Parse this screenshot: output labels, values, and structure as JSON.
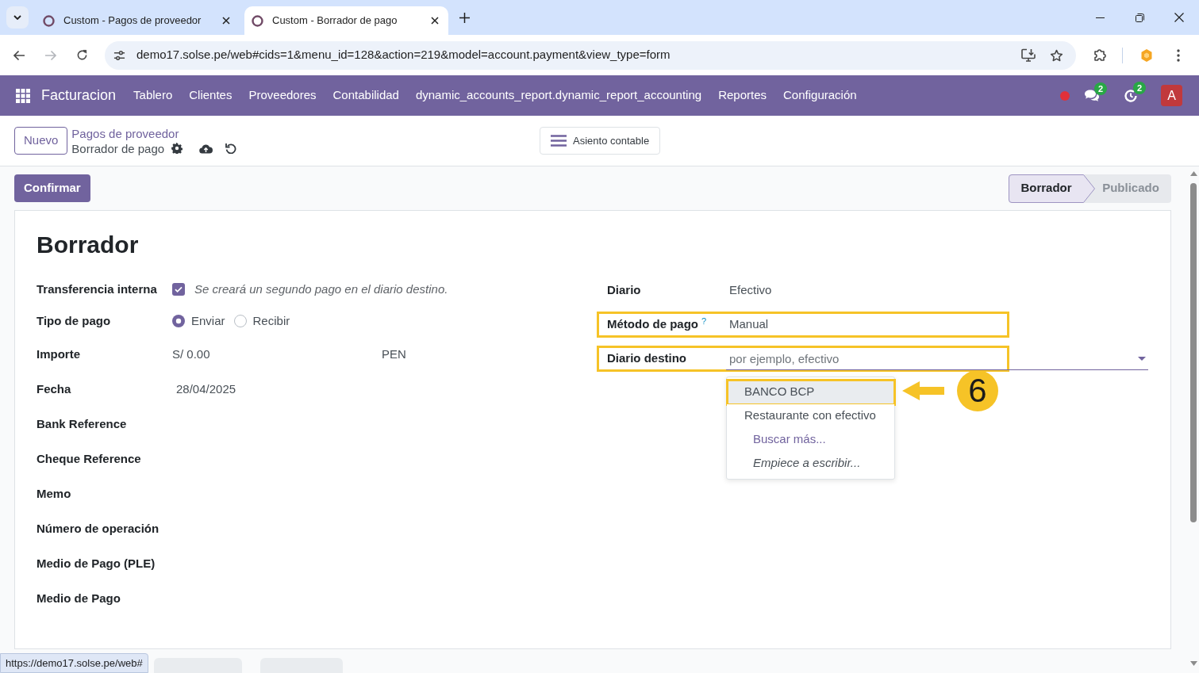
{
  "browser": {
    "tabs": [
      {
        "title": "Custom - Pagos de proveedor",
        "selected": false
      },
      {
        "title": "Custom - Borrador de pago",
        "selected": true
      }
    ],
    "url": "demo17.solse.pe/web#cids=1&menu_id=128&action=219&model=account.payment&view_type=form",
    "forward_disabled": true
  },
  "navbar": {
    "app_name": "Facturacion",
    "menu": [
      "Tablero",
      "Clientes",
      "Proveedores",
      "Contabilidad",
      "dynamic_accounts_report.dynamic_report_accounting",
      "Reportes",
      "Configuración"
    ],
    "messages_count": "2",
    "activities_count": "2",
    "avatar_letter": "A"
  },
  "control_panel": {
    "new_button": "Nuevo",
    "breadcrumb": "Pagos de proveedor",
    "record_name": "Borrador de pago",
    "action_button": "Asiento contable"
  },
  "status_row": {
    "buttons": [
      "Confirmar"
    ],
    "stages": [
      {
        "label": "Borrador",
        "selected": true
      },
      {
        "label": "Publicado",
        "selected": false
      }
    ]
  },
  "form": {
    "title": "Borrador",
    "left_fields": [
      {
        "kind": "checkbox",
        "label": "Transferencia interna",
        "checked": true,
        "note": "Se creará un segundo pago en el diario destino."
      },
      {
        "kind": "radio",
        "label": "Tipo de pago",
        "options": [
          {
            "label": "Enviar",
            "selected": true
          },
          {
            "label": "Recibir",
            "selected": false
          }
        ]
      },
      {
        "kind": "amount",
        "label": "Importe",
        "value": "S/ 0.00",
        "currency": "PEN"
      },
      {
        "kind": "text",
        "label": "Fecha",
        "value": "28/04/2025"
      },
      {
        "kind": "empty",
        "label": "Bank Reference"
      },
      {
        "kind": "empty",
        "label": "Cheque Reference"
      },
      {
        "kind": "empty",
        "label": "Memo"
      },
      {
        "kind": "empty",
        "label": "Número de operación"
      },
      {
        "kind": "empty",
        "label": "Medio de Pago (PLE)"
      },
      {
        "kind": "empty",
        "label": "Medio de Pago"
      }
    ],
    "right_fields": [
      {
        "kind": "text",
        "label": "Diario",
        "value": "Efectivo",
        "highlighted": false
      },
      {
        "kind": "text",
        "label": "Método de pago",
        "help": "?",
        "value": "Manual",
        "highlighted": true
      },
      {
        "kind": "select",
        "label": "Diario destino",
        "placeholder": "por ejemplo, efectivo",
        "highlighted": true,
        "options": [
          {
            "kind": "record",
            "label": "BANCO BCP",
            "selected": true,
            "highlighted": true
          },
          {
            "kind": "record",
            "label": "Restaurante con efectivo",
            "selected": false,
            "highlighted": false
          },
          {
            "kind": "search_more",
            "label": "Buscar más..."
          },
          {
            "kind": "hint",
            "label": "Empiece a escribir..."
          }
        ]
      }
    ]
  },
  "callout": {
    "number": "6"
  },
  "link_preview": "https://demo17.solse.pe/web#"
}
